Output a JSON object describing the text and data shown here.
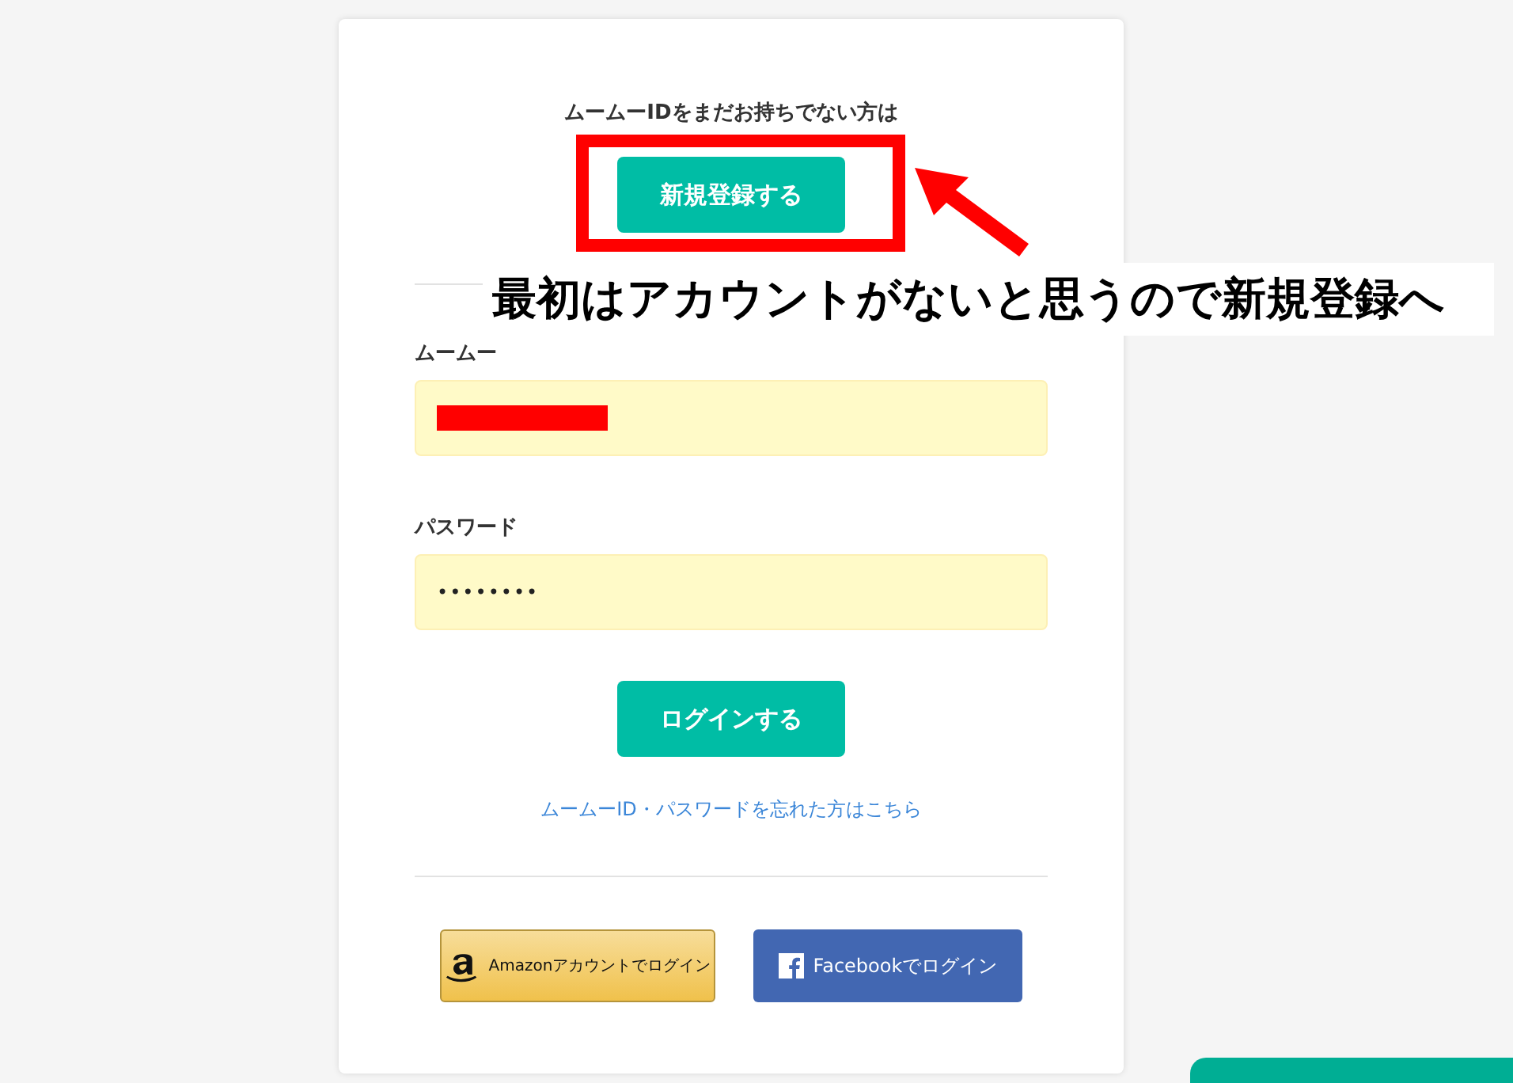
{
  "intro_text": "ムームーIDをまだお持ちでない方は",
  "register_button": "新規登録する",
  "fields": [
    {
      "label": "ムームー",
      "redacted": true
    },
    {
      "label": "パスワード",
      "value": "••••••••"
    }
  ],
  "login_button": "ログインする",
  "forgot_link": "ムームーID・パスワードを忘れた方はこちら",
  "social_buttons": [
    {
      "kind": "amazon",
      "label": "Amazonアカウントでログイン"
    },
    {
      "kind": "facebook",
      "label": "Facebookでログイン"
    }
  ],
  "annotation": {
    "text": "最初はアカウントがないと思うので新規登録へ"
  },
  "floating_tab": {
    "kind": "help"
  }
}
